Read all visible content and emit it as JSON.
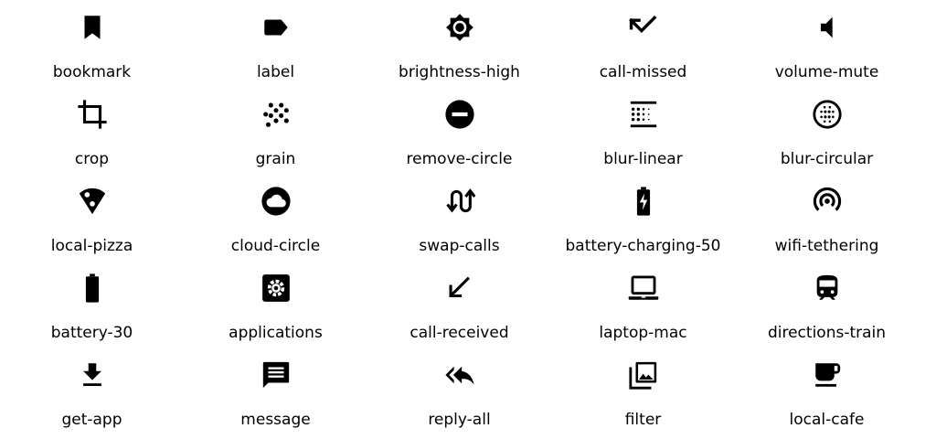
{
  "icons": [
    {
      "name": "bookmark",
      "label": "bookmark"
    },
    {
      "name": "label",
      "label": "label"
    },
    {
      "name": "brightness-high",
      "label": "brightness-high"
    },
    {
      "name": "call-missed",
      "label": "call-missed"
    },
    {
      "name": "volume-mute",
      "label": "volume-mute"
    },
    {
      "name": "crop",
      "label": "crop"
    },
    {
      "name": "grain",
      "label": "grain"
    },
    {
      "name": "remove-circle",
      "label": "remove-circle"
    },
    {
      "name": "blur-linear",
      "label": "blur-linear"
    },
    {
      "name": "blur-circular",
      "label": "blur-circular"
    },
    {
      "name": "local-pizza",
      "label": "local-pizza"
    },
    {
      "name": "cloud-circle",
      "label": "cloud-circle"
    },
    {
      "name": "swap-calls",
      "label": "swap-calls"
    },
    {
      "name": "battery-charging-50",
      "label": "battery-charging-50"
    },
    {
      "name": "wifi-tethering",
      "label": "wifi-tethering"
    },
    {
      "name": "battery-30",
      "label": "battery-30"
    },
    {
      "name": "applications",
      "label": "applications"
    },
    {
      "name": "call-received",
      "label": "call-received"
    },
    {
      "name": "laptop-mac",
      "label": "laptop-mac"
    },
    {
      "name": "directions-train",
      "label": "directions-train"
    },
    {
      "name": "get-app",
      "label": "get-app"
    },
    {
      "name": "message",
      "label": "message"
    },
    {
      "name": "reply-all",
      "label": "reply-all"
    },
    {
      "name": "filter",
      "label": "filter"
    },
    {
      "name": "local-cafe",
      "label": "local-cafe"
    }
  ]
}
